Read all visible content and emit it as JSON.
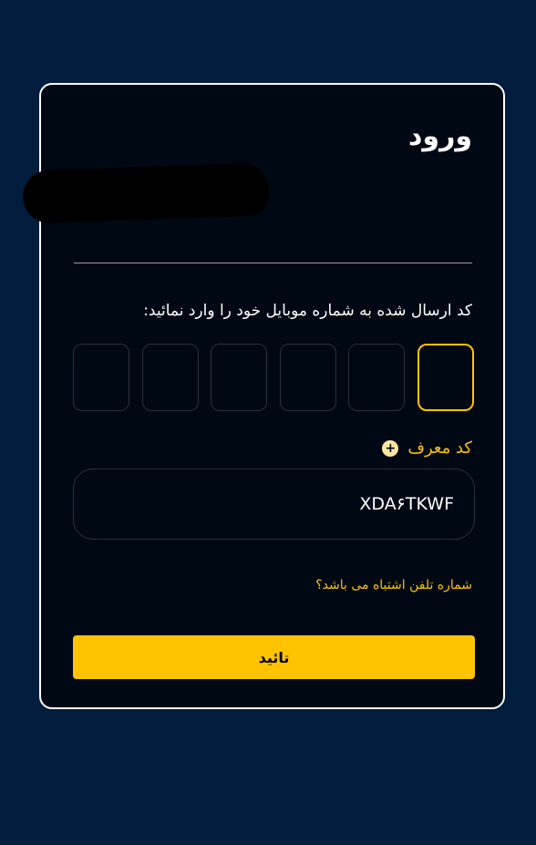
{
  "login": {
    "title": "ورود",
    "instruction": "کد ارسال شده به شماره موبایل خود را وارد نمائید:",
    "otp_boxes": [
      "",
      "",
      "",
      "",
      "",
      ""
    ],
    "referral_label": "کد معرف",
    "referral_icon": "plus-circle-icon",
    "referral_value": "XDA۶TKWF",
    "wrong_number_text": "شماره تلفن اشتباه می باشد؟",
    "confirm_label": "تائید"
  },
  "colors": {
    "background": "#001d3d",
    "card": "#000814",
    "accent": "#ffc300",
    "text": "#ffffff"
  }
}
